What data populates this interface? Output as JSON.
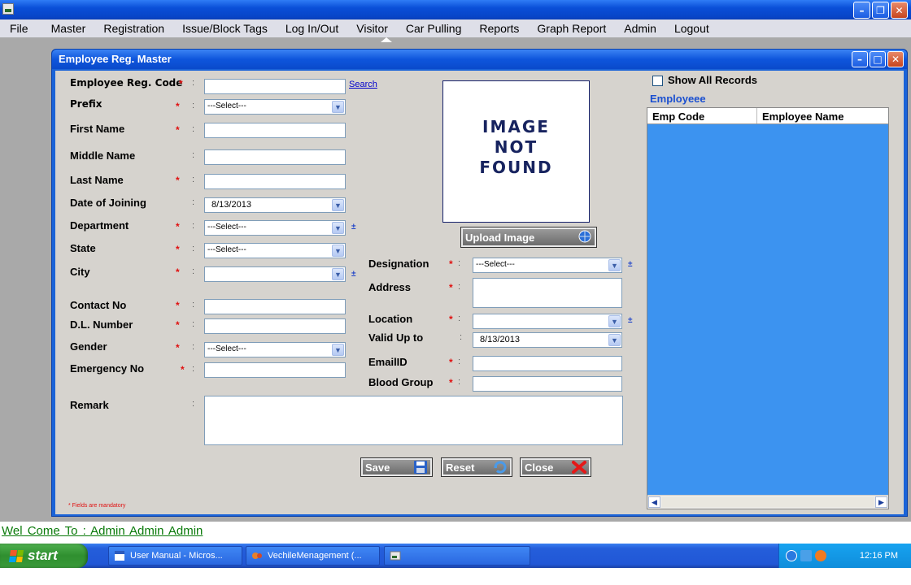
{
  "menu": [
    "File",
    "Master",
    "Registration",
    "Issue/Block Tags",
    "Log In/Out",
    "Visitor",
    "Car Pulling",
    "Reports",
    "Graph Report",
    "Admin",
    "Logout"
  ],
  "form": {
    "title": "Employee Reg. Master",
    "fields": {
      "emp_code": {
        "label": "Employee Reg. Code",
        "value": ""
      },
      "prefix": {
        "label": "Prefix",
        "value": "---Select---"
      },
      "first_name": {
        "label": "First Name",
        "value": ""
      },
      "middle_name": {
        "label": "Middle Name",
        "value": ""
      },
      "last_name": {
        "label": "Last Name",
        "value": ""
      },
      "doj": {
        "label": "Date of Joining",
        "value": "8/13/2013"
      },
      "department": {
        "label": "Department",
        "value": "---Select---"
      },
      "state": {
        "label": "State",
        "value": "---Select---"
      },
      "city": {
        "label": "City",
        "value": ""
      },
      "contact": {
        "label": "Contact No",
        "value": ""
      },
      "dl": {
        "label": "D.L. Number",
        "value": ""
      },
      "gender": {
        "label": "Gender",
        "value": "---Select---"
      },
      "emergency": {
        "label": "Emergency No",
        "value": ""
      },
      "designation": {
        "label": "Designation",
        "value": "---Select---"
      },
      "address": {
        "label": "Address",
        "value": ""
      },
      "location": {
        "label": "Location",
        "value": ""
      },
      "valid_up_to": {
        "label": "Valid Up to",
        "value": "8/13/2013"
      },
      "email": {
        "label": "EmailID",
        "value": ""
      },
      "blood_group": {
        "label": "Blood Group",
        "value": ""
      },
      "remark": {
        "label": "Remark",
        "value": ""
      }
    },
    "search_link": "Search",
    "image_placeholder": [
      "IMAGE",
      "NOT",
      "FOUND"
    ],
    "upload_button": "Upload Image",
    "save_button": "Save",
    "reset_button": "Reset",
    "close_button": "Close",
    "mandatory_note": "* Fields are mandatory",
    "required_mark": "*",
    "add_mark": "±",
    "colon": ":"
  },
  "employee_panel": {
    "show_all_label": "Show All Records",
    "title": "Employeee",
    "columns": [
      "Emp Code",
      "Employee Name"
    ],
    "rows": []
  },
  "welcome": "Wel Come To : Admin   Admin   Admin",
  "taskbar": {
    "start": "start",
    "tasks": [
      "User Manual - Micros...",
      "VechileMenagement (...",
      ""
    ],
    "clock": "12:16 PM"
  },
  "colors": {
    "accent": "#1a63d8",
    "grid_bg": "#3c93f0",
    "required": "#e01010",
    "welcome": "#0a7a0a"
  }
}
